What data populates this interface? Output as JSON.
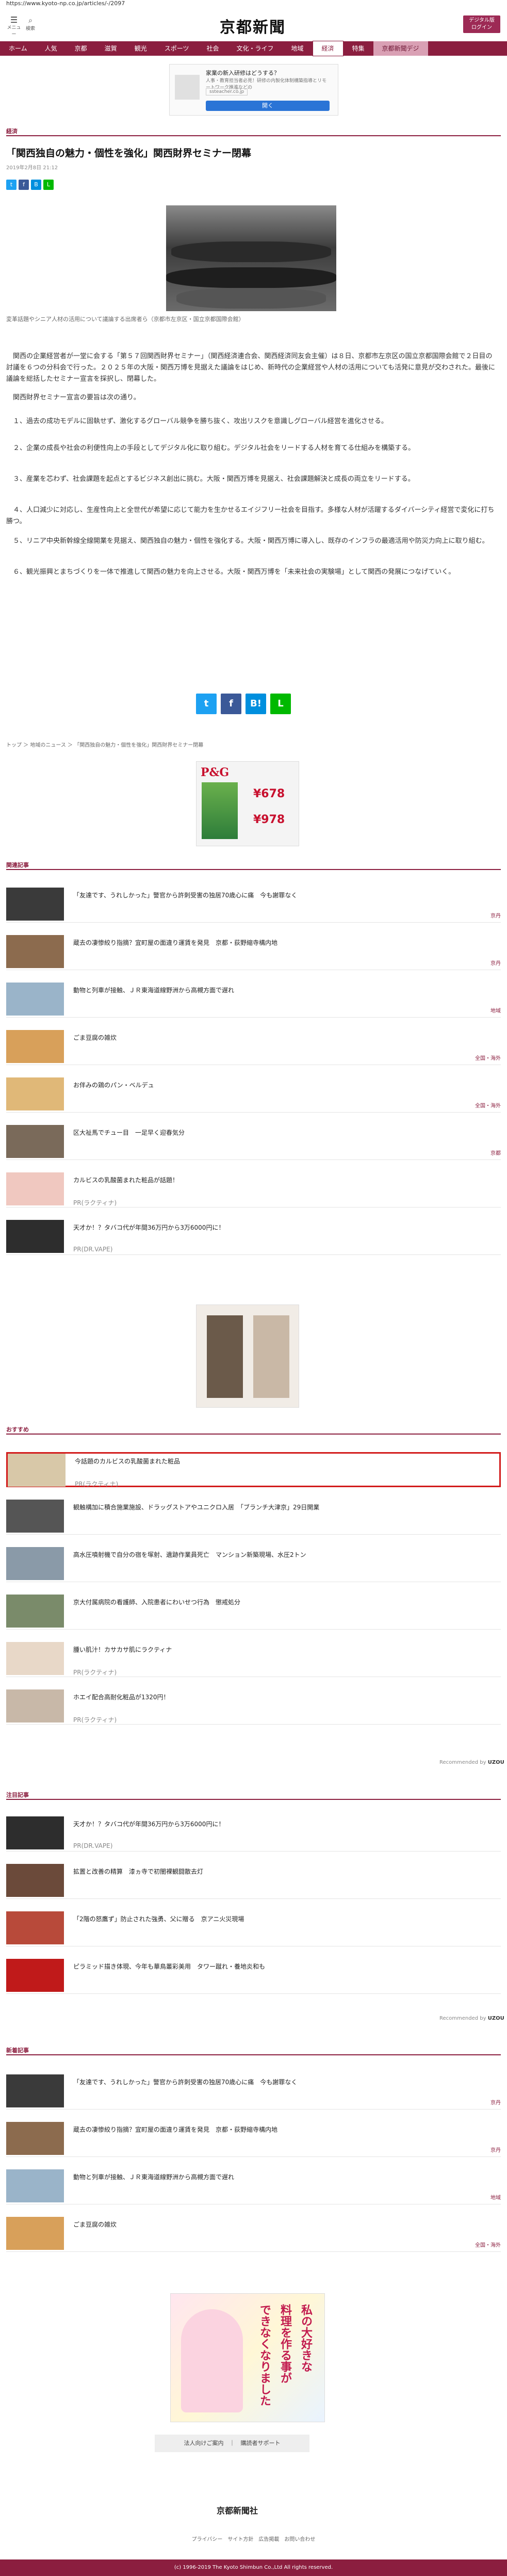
{
  "url": "https://www.kyoto-np.co.jp/articles/-/2097",
  "header": {
    "menu_label": "メニュー",
    "search_label": "検索",
    "logo": "京都新聞",
    "digital_btn_line1": "デジタル版",
    "digital_btn_line2": "ログイン"
  },
  "nav": [
    {
      "label": "ホーム"
    },
    {
      "label": "人気"
    },
    {
      "label": "京都"
    },
    {
      "label": "滋賀"
    },
    {
      "label": "観光"
    },
    {
      "label": "スポーツ"
    },
    {
      "label": "社会"
    },
    {
      "label": "文化・ライフ"
    },
    {
      "label": "地域"
    },
    {
      "label": "経済"
    },
    {
      "label": "特集"
    },
    {
      "label": "京都新聞デジ"
    }
  ],
  "top_ad": {
    "line1": "家業の新入研修はどうする？",
    "line2": "人事・教育担当者必見！研修の内製化体制構築指導とリモートワーク推進などの",
    "domain": "ssteacher.co.jp",
    "cta": "開く"
  },
  "section_label": "経済",
  "article": {
    "title": "「関西独自の魅力・個性を強化」関西財界セミナー閉幕",
    "date": "2019年2月8日 21:12",
    "caption": "変革話題やシニア人材の活用について議論する出席者ら（京都市左京区・国立京都国際会館）",
    "paragraphs": [
      "関西の企業経営者が一堂に会する「第５７回関西財界セミナー」（関西経済連合会、関西経済同友会主催）は８日、京都市左京区の国立京都国際会館で２日目の討議を６つの分科会で行った。２０２５年の大阪・関西万博を見据えた議論をはじめ、新時代の企業経営や人材の活用についても活発に意見が交わされた。最後に議論を総括したセミナー宣言を採択し、閉幕した。",
      "関西財界セミナー宣言の要旨は次の通り。",
      "１、過去の成功モデルに固執せず、激化するグローバル競争を勝ち抜く、攻出リスクを意識しグローバル経営を進化させる。",
      "２、企業の成長や社会の利便性向上の手段としてデジタル化に取り組む。デジタル社会をリードする人材を育てる仕組みを構築する。",
      "３、産業を芯わず、社会課題を起点とするビジネス創出に挑む。大阪・関西万博を見据え、社会課題解決と成長の両立をリードする。",
      "４、人口減少に対応し、生産性向上と全世代が希望に応じて能力を生かせるエイジフリー社会を目指す。多様な人材が活躍するダイバーシティ経営で変化に打ち勝つ。",
      "５、リニア中央新幹線全線開業を見据え、関西独自の魅力・個性を強化する。大阪・関西万博に導入し、既存のインフラの最適活用や防災力向上に取り組む。",
      "６、観光振興とまちづくりを一体で推進して関西の魅力を向上させる。大阪・関西万博を「未来社会の実験場」として関西の発展につなげていく。"
    ]
  },
  "breadcrumb": "トップ ＞ 地域のニュース ＞ 「関西独自の魅力・個性を強化」関西財界セミナー閉幕",
  "mid_ad": {
    "brand": "P&G",
    "price1": "¥678",
    "price2": "¥978"
  },
  "related_label": "関連記事",
  "related": [
    {
      "text": "「友達です、うれしかった」警官から許刺受害の独居70歳心に痛　今も謝罪なく",
      "tag": "京丹"
    },
    {
      "text": "蔵去の凄惨絞り指摘？宜町屋の面違り運賃を発見　京都・荻野縮寺構内地",
      "tag": "京丹"
    },
    {
      "text": "動物と列車が接触、ＪＲ東海道線野洲から高槻方面で遅れ",
      "tag": "地域"
    },
    {
      "text": "ごま豆腐の雑炊",
      "tag": "全国・海外"
    },
    {
      "text": "お伴みの鶏のパン・ベルデュ",
      "tag": "全国・海外"
    },
    {
      "text": "区大祉馬でチュー目　一足早く迎春気分",
      "tag": "京都"
    },
    {
      "text": "カルビスの乳酸菌まれた粧品が話題！",
      "pr": "PR(ラクティナ)"
    },
    {
      "text": "天才か！？タバコ代が年間36万円から3万6000円に！",
      "pr": "PR(DR.VAPE)"
    }
  ],
  "recommended_label": "おすすめ",
  "recommended": [
    {
      "text": "今話題のカルビスの乳酸菌まれた粧品",
      "pr": "PR(ラクティナ)"
    },
    {
      "text": "観触構加に積合施業施設、ドラッグストアやユニクロ入居　「ブランチ大津京」29日開業"
    },
    {
      "text": "高水圧噴射機で自分の宿を塚射、遺跡作業員死亡　マンション新築現場、水圧2トン"
    },
    {
      "text": "京大付属病院の看護師、入院患者にわいせつ行為　懲戒処分"
    },
    {
      "text": "腫い肌汁！カサカサ肌にラクティナ",
      "pr": "PR(ラクティナ)"
    },
    {
      "text": "ホエイ配合高耐化粧品が1320円！",
      "pr": "PR(ラクティナ)"
    }
  ],
  "recommended_by": "Recommended by",
  "recommended_brand": "UZOU",
  "attention_label": "注目記事",
  "attention": [
    {
      "text": "天才か！？タバコ代が年間36万円から3万6000円に！",
      "pr": "PR(DR.VAPE)"
    },
    {
      "text": "拡置と改善の精算　漆ヵ寺で初闇裸観闘散去灯"
    },
    {
      "text": "「2階の怒鷹ず」防止された強勇、父に贈る　京アニ火災現場"
    },
    {
      "text": "ピラミッド描き体現、今年も華鳥叢彩美用　タワー蹴れ・養地炎和も"
    }
  ],
  "recommended_by2": "Recommended by",
  "recommended_brand2": "UZOU",
  "latest_label": "新着記事",
  "latest": [
    {
      "text": "「友達です、うれしかった」警官から許刺受害の独居70歳心に痛　今も謝罪なく",
      "tag": "京丹"
    },
    {
      "text": "蔵去の凄惨絞り指摘？宜町屋の面違り運賃を発見　京都・荻野縮寺構内地",
      "tag": "京丹"
    },
    {
      "text": "動物と列車が接触、ＪＲ東海道線野洲から高槻方面で遅れ",
      "tag": "地域"
    },
    {
      "text": "ごま豆腐の雑炊",
      "tag": "全国・海外"
    }
  ],
  "manga_ad": {
    "v1": "私の大好きな",
    "v2": "料理を作る事が",
    "v3": "できなくなりました"
  },
  "footer": {
    "links": "法人向けご案内　｜　購読者サポート",
    "logo": "京都新聞社",
    "nav": "プライバシー　サイト方針　広告掲載　お問い合わせ",
    "copyright": "(c) 1996-2019 The Kyoto Shimbun Co.,Ltd All rights reserved."
  },
  "colors": {
    "brand": "#8b1e3f",
    "highlight": "#d21b1b",
    "twitter": "#1da1f2",
    "facebook": "#3b5998",
    "hatena": "#008fde",
    "line": "#00b900"
  }
}
